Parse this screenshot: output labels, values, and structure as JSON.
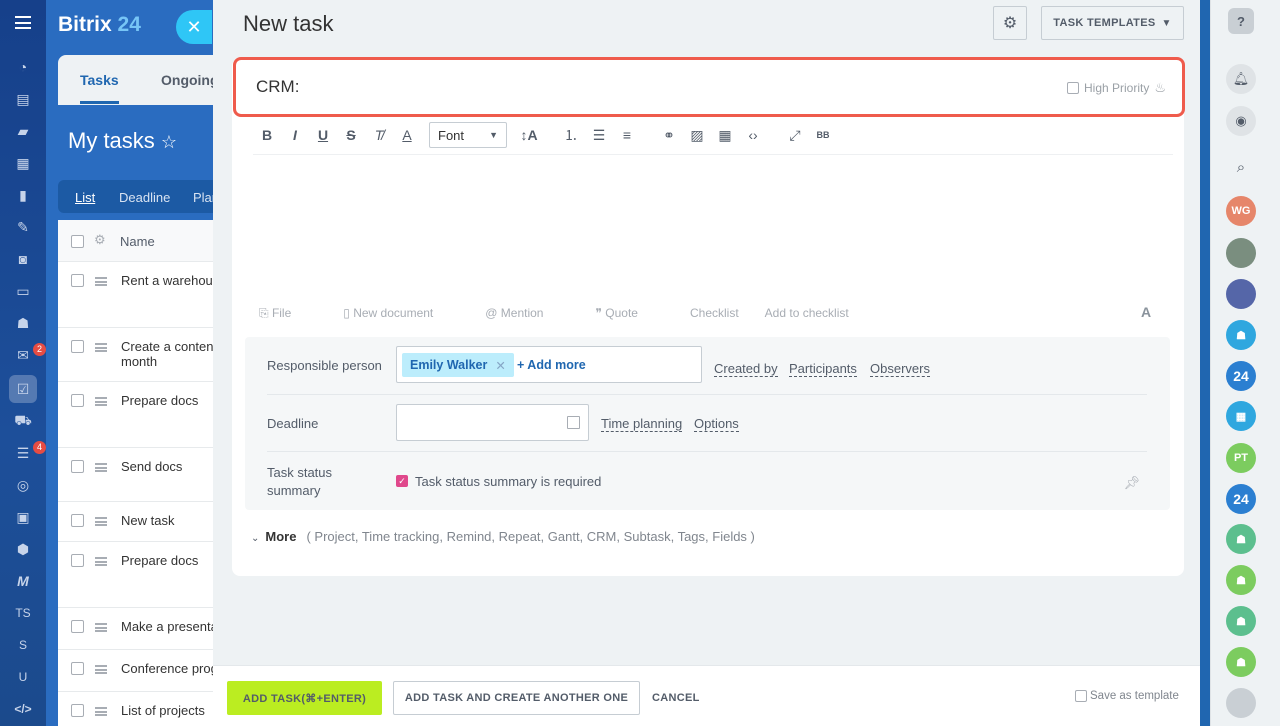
{
  "app": {
    "brand_main": "Bitrix",
    "brand_accent": "24"
  },
  "left_nav": {
    "badges": [
      "2",
      "4"
    ],
    "text_items": [
      "TS",
      "S",
      "U",
      "</>"
    ]
  },
  "background": {
    "tabs": [
      "Tasks",
      "Ongoing"
    ],
    "page_title": "My tasks",
    "view_tabs": [
      "List",
      "Deadline",
      "Plan"
    ],
    "name_header": "Name",
    "rows": [
      "Rent a warehouse",
      "Create a content month",
      "Prepare docs",
      "Send docs",
      "New task",
      "Prepare docs",
      "Make a presenta",
      "Conference prog",
      "List of projects"
    ]
  },
  "slider": {
    "title": "New task",
    "templates_button": "TASK TEMPLATES",
    "task_title_value": "CRM:",
    "high_priority_label": "High Priority",
    "font_select": "Font",
    "attachments": [
      "File",
      "New document",
      "Mention",
      "Quote",
      "Checklist",
      "Add to checklist"
    ],
    "responsible_label": "Responsible person",
    "responsible_chip": "Emily Walker",
    "add_more": "+ Add more",
    "role_links": [
      "Created by",
      "Participants",
      "Observers"
    ],
    "deadline_label": "Deadline",
    "deadline_links": [
      "Time planning",
      "Options"
    ],
    "status_label_1": "Task status",
    "status_label_2": "summary",
    "status_checkbox_label": "Task status summary is required",
    "more_label": "More",
    "more_items": "( Project,  Time tracking,  Remind,  Repeat,  Gantt,  CRM,  Subtask,  Tags,  Fields )",
    "add_task_button": "ADD TASK(⌘+ENTER)",
    "add_another_button": "ADD TASK AND CREATE ANOTHER ONE",
    "cancel_button": "CANCEL",
    "save_template_label": "Save as template"
  },
  "right_bar": {
    "avatars": [
      "WG",
      "PT"
    ],
    "badge24": "24"
  },
  "colors": {
    "accent_blue": "#2067b0",
    "add_green": "#bbed21",
    "highlight_red": "#ef5b4c"
  }
}
